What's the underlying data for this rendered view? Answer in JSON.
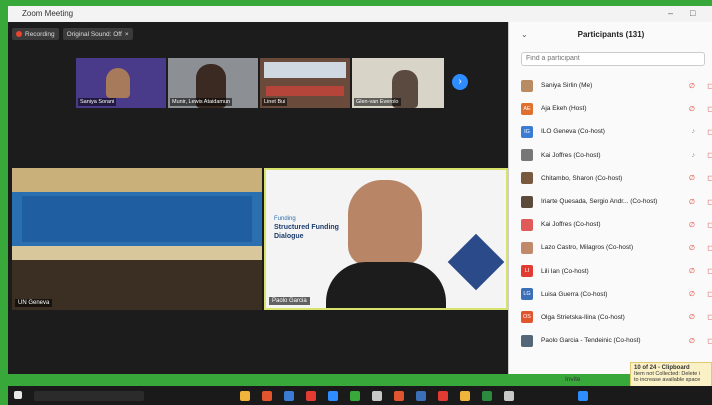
{
  "window": {
    "title": "Zoom Meeting"
  },
  "controls": {
    "minimize": "–",
    "maximize": "□"
  },
  "toolbar": {
    "recording_label": "Recording",
    "original_sound_label": "Original Sound: Off"
  },
  "thumbnails": [
    {
      "name": "Saniya Sorani"
    },
    {
      "name": "Munir, Lewis Ataidamun"
    },
    {
      "name": "Linet Bui"
    },
    {
      "name": "Glen-van Everolo"
    }
  ],
  "next_arrow": "›",
  "tiles": [
    {
      "name": "UN Geneva"
    },
    {
      "name": "Paolo Garcia"
    }
  ],
  "slide": {
    "line1": "Funding",
    "line2": "Structured Funding",
    "line3": "Dialogue"
  },
  "participants": {
    "header": "Participants (131)",
    "search_placeholder": "Find a participant",
    "invite_label": "Invite",
    "list": [
      {
        "name": "Saniya Sirlin (Me)",
        "initials": "",
        "color": "#b98b62"
      },
      {
        "name": "Aja Ekeh (Host)",
        "initials": "AE",
        "color": "#e07030"
      },
      {
        "name": "ILO Geneva (Co-host)",
        "initials": "IG",
        "color": "#3b7bd4"
      },
      {
        "name": "Kai Joffres (Co-host)",
        "initials": "",
        "color": "#777777"
      },
      {
        "name": "Chitambo, Sharon (Co-host)",
        "initials": "",
        "color": "#7a5a3e"
      },
      {
        "name": "Iriarte Quesada, Sergio Andr... (Co-host)",
        "initials": "",
        "color": "#5c4a3a"
      },
      {
        "name": "Kai Joffres (Co-host)",
        "initials": "",
        "color": "#e05a5a"
      },
      {
        "name": "Lazo Castro, Milagros (Co-host)",
        "initials": "",
        "color": "#c08a6a"
      },
      {
        "name": "Lili Ian (Co-host)",
        "initials": "LI",
        "color": "#e23b32"
      },
      {
        "name": "Luisa Guerra (Co-host)",
        "initials": "LG",
        "color": "#3b6fb8"
      },
      {
        "name": "Olga Strietska-Ilina (Co-host)",
        "initials": "OS",
        "color": "#e0552e"
      },
      {
        "name": "Paolo Garcia - Tendeinic (Co-host)",
        "initials": "",
        "color": "#556677"
      }
    ]
  },
  "clipboard": {
    "title": "10 of 24 - Clipboard",
    "line1": "Item not Collected: Delete i",
    "line2": "to increase available space"
  }
}
